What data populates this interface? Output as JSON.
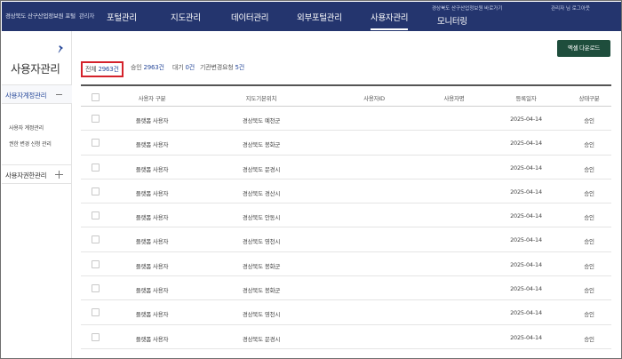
{
  "header": {
    "brand": "경상북도 산구산업정보원 포털",
    "brand_sub": "관리자",
    "nav": [
      {
        "label": "포털관리",
        "active": false
      },
      {
        "label": "지도관리",
        "active": false
      },
      {
        "label": "데이터관리",
        "active": false
      },
      {
        "label": "외부포털관리",
        "active": false
      },
      {
        "label": "사용자관리",
        "active": true
      },
      {
        "label": "모니터링",
        "active": false
      }
    ],
    "top_link": "경상북도 산구산업정보원 바로가기",
    "user_info": "관리자 님 로그아웃"
  },
  "sidebar": {
    "title": "사용자관리",
    "sections": [
      {
        "label": "사용자계정관리",
        "expanded": true,
        "items": [
          "사용자 계정관리",
          "권한 변경 신청 관리"
        ]
      },
      {
        "label": "사용자권한관리",
        "expanded": false,
        "items": []
      }
    ]
  },
  "summary": {
    "total_label": "전체",
    "total_value": "2963건",
    "approved_label": "승인",
    "approved_value": "2963건",
    "pending_label": "대기",
    "pending_value": "0건",
    "region_change_label": "기관변경요청",
    "region_change_value": "5건"
  },
  "excel_button": "엑셀 다운로드",
  "table": {
    "headers": [
      "사용자 구분",
      "지도기본위치",
      "사용자ID",
      "사용자명",
      "등록일자",
      "상태구분"
    ],
    "rows": [
      {
        "type": "플랫폼 사용자",
        "region": "경상북도 예천군",
        "user_id": "",
        "user_name": "",
        "date": "2025-04-14",
        "status": "승인"
      },
      {
        "type": "플랫폼 사용자",
        "region": "경상북도 봉화군",
        "user_id": "",
        "user_name": "",
        "date": "2025-04-14",
        "status": "승인"
      },
      {
        "type": "플랫폼 사용자",
        "region": "경상북도 문경시",
        "user_id": "",
        "user_name": "",
        "date": "2025-04-14",
        "status": "승인"
      },
      {
        "type": "플랫폼 사용자",
        "region": "경상북도 경산시",
        "user_id": "",
        "user_name": "",
        "date": "2025-04-14",
        "status": "승인"
      },
      {
        "type": "플랫폼 사용자",
        "region": "경상북도 안동시",
        "user_id": "",
        "user_name": "",
        "date": "2025-04-14",
        "status": "승인"
      },
      {
        "type": "플랫폼 사용자",
        "region": "경상북도 영천시",
        "user_id": "",
        "user_name": "",
        "date": "2025-04-14",
        "status": "승인"
      },
      {
        "type": "플랫폼 사용자",
        "region": "경상북도 봉화군",
        "user_id": "",
        "user_name": "",
        "date": "2025-04-14",
        "status": "승인"
      },
      {
        "type": "플랫폼 사용자",
        "region": "경상북도 봉화군",
        "user_id": "",
        "user_name": "",
        "date": "2025-04-14",
        "status": "승인"
      },
      {
        "type": "플랫폼 사용자",
        "region": "경상북도 영천시",
        "user_id": "",
        "user_name": "",
        "date": "2025-04-14",
        "status": "승인"
      },
      {
        "type": "플랫폼 사용자",
        "region": "경상북도 문경시",
        "user_id": "",
        "user_name": "",
        "date": "2025-04-14",
        "status": "승인"
      }
    ]
  }
}
